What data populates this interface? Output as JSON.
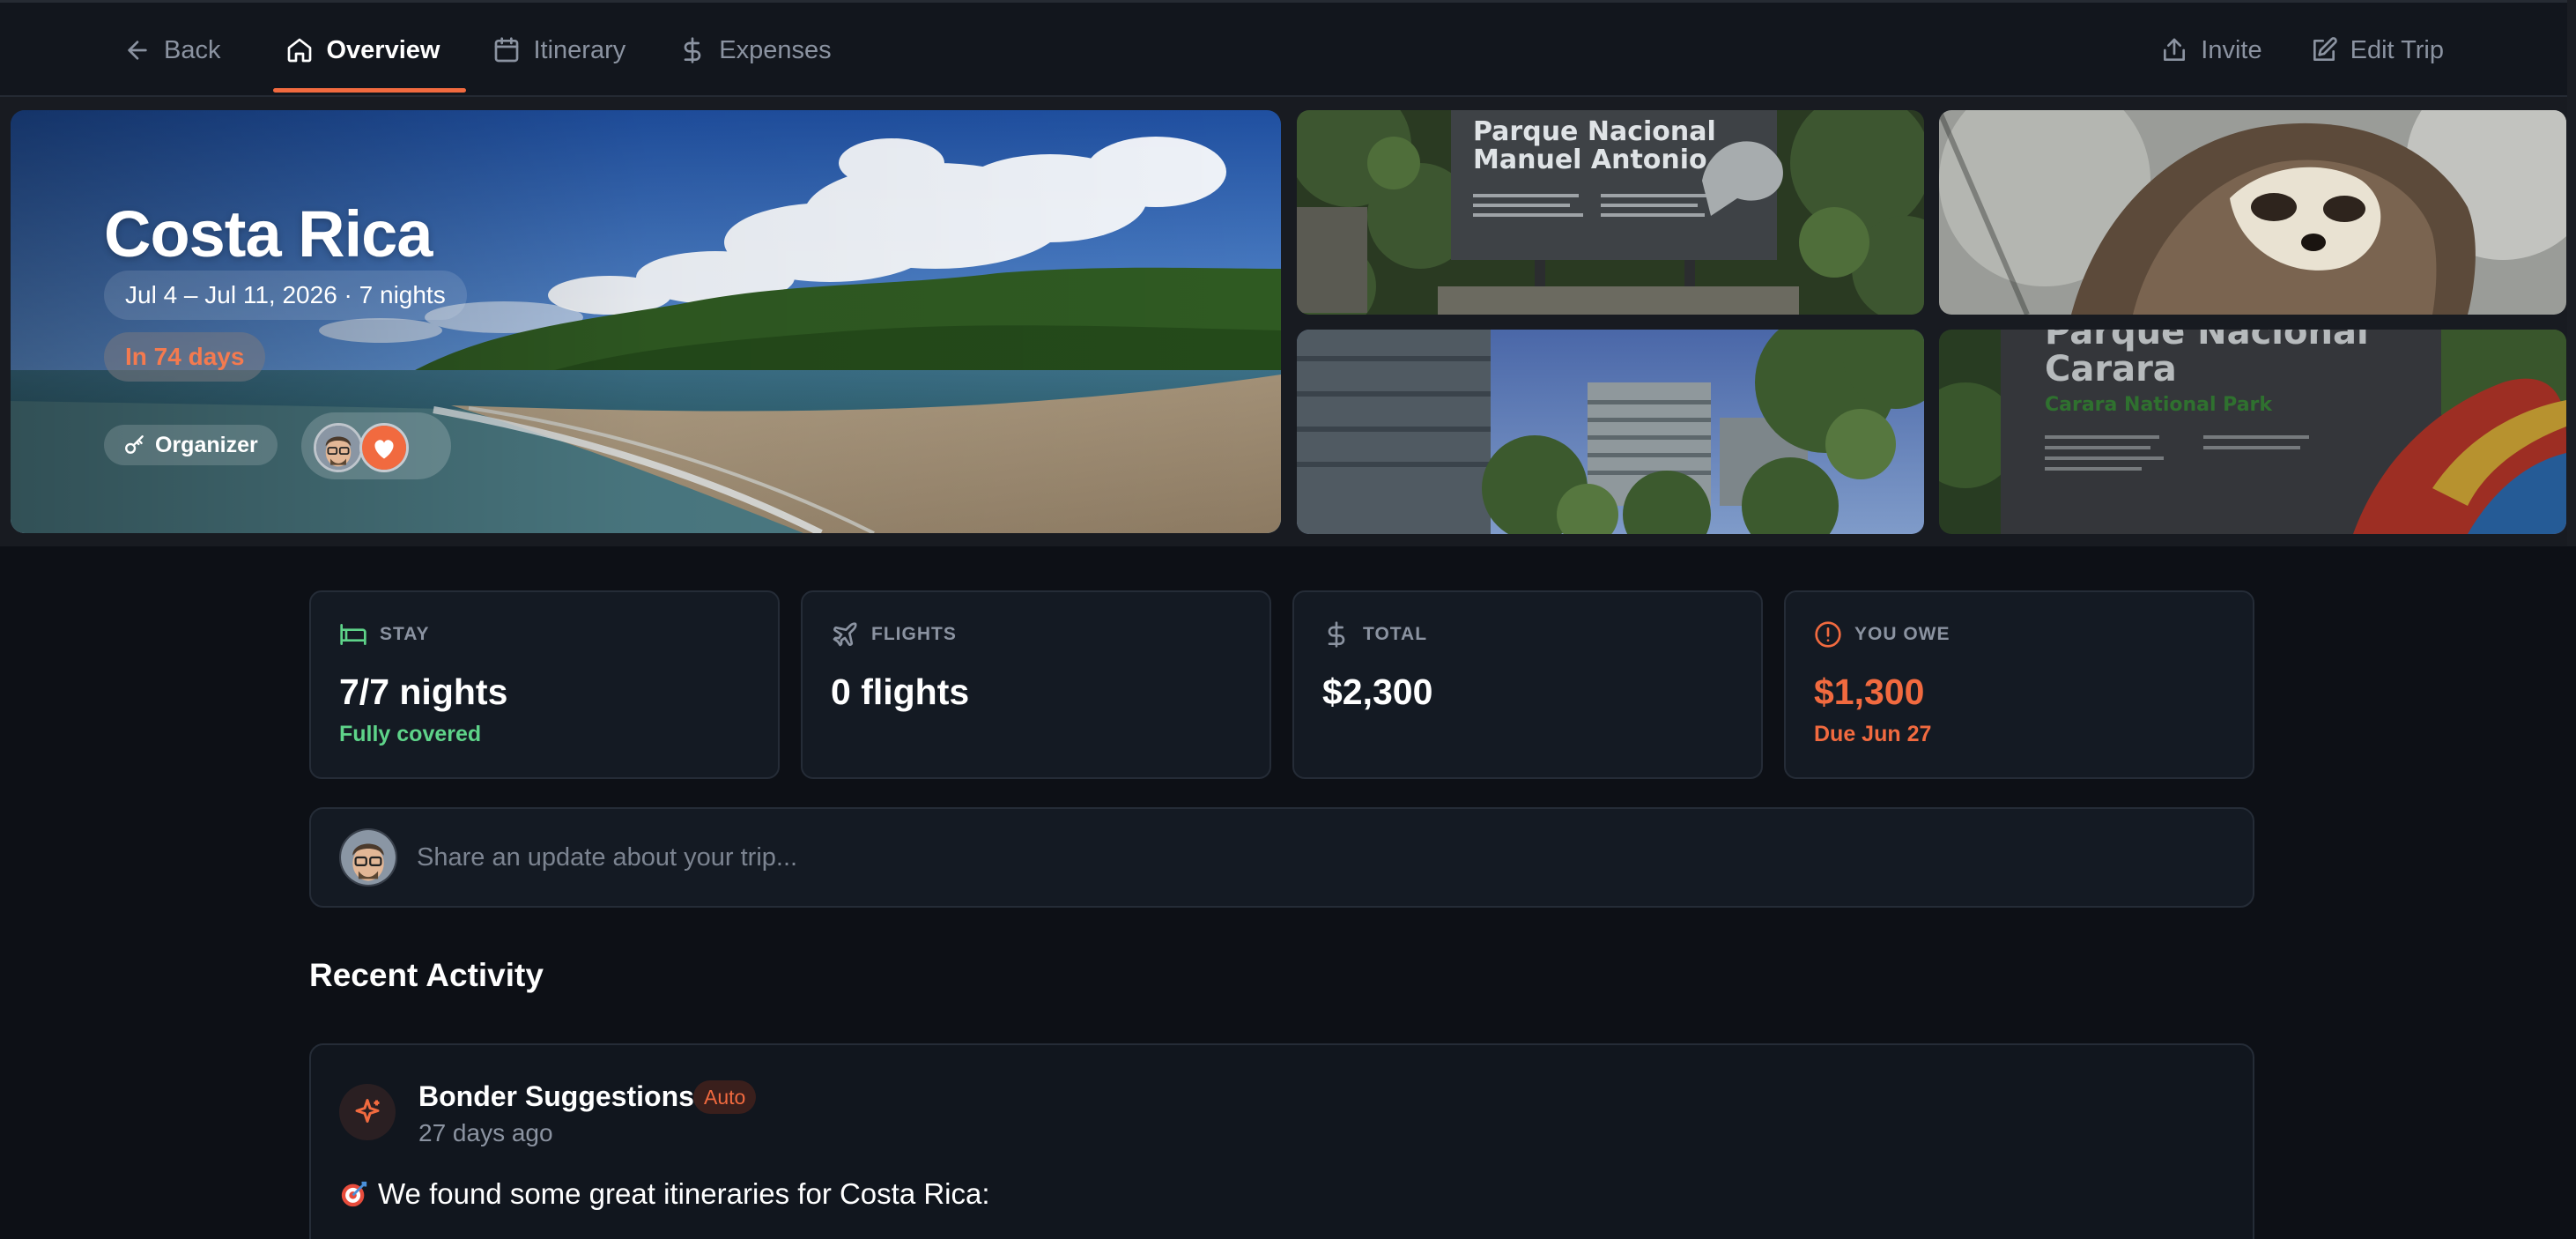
{
  "nav": {
    "back": "Back",
    "tabs": [
      {
        "label": "Overview",
        "icon": "home-icon",
        "active": true
      },
      {
        "label": "Itinerary",
        "icon": "calendar-icon",
        "active": false
      },
      {
        "label": "Expenses",
        "icon": "dollar-icon",
        "active": false
      }
    ],
    "invite": "Invite",
    "edit": "Edit Trip"
  },
  "trip": {
    "title": "Costa Rica",
    "dates": "Jul 4 – Jul 11, 2026 · 7 nights",
    "countdown": "In 74 days",
    "role": "Organizer"
  },
  "gallery": {
    "sign1_line1": "Parque Nacional",
    "sign1_line2": "Manuel Antonio",
    "sign2_line1": "Parque Nacional",
    "sign2_line2": "Carara",
    "sign2_line3": "Carara National Park"
  },
  "stats": [
    {
      "label": "STAY",
      "icon": "bed-icon",
      "value": "7/7 nights",
      "sub": "Fully covered"
    },
    {
      "label": "FLIGHTS",
      "icon": "plane-icon",
      "value": "0 flights",
      "sub": ""
    },
    {
      "label": "TOTAL",
      "icon": "dollar-icon",
      "value": "$2,300",
      "sub": ""
    },
    {
      "label": "YOU OWE",
      "icon": "alert-circle-icon",
      "value": "$1,300",
      "sub": "Due Jun 27"
    }
  ],
  "composer": {
    "placeholder": "Share an update about your trip..."
  },
  "activity": {
    "title": "Recent Activity",
    "items": [
      {
        "author": "Bonder Suggestions",
        "badge": "Auto",
        "time": "27 days ago",
        "text": "We found some great itineraries for Costa Rica:"
      }
    ]
  },
  "colors": {
    "accent": "#f16a3f",
    "success": "#5ed389",
    "background": "#0d1016",
    "card": "#141a23"
  }
}
